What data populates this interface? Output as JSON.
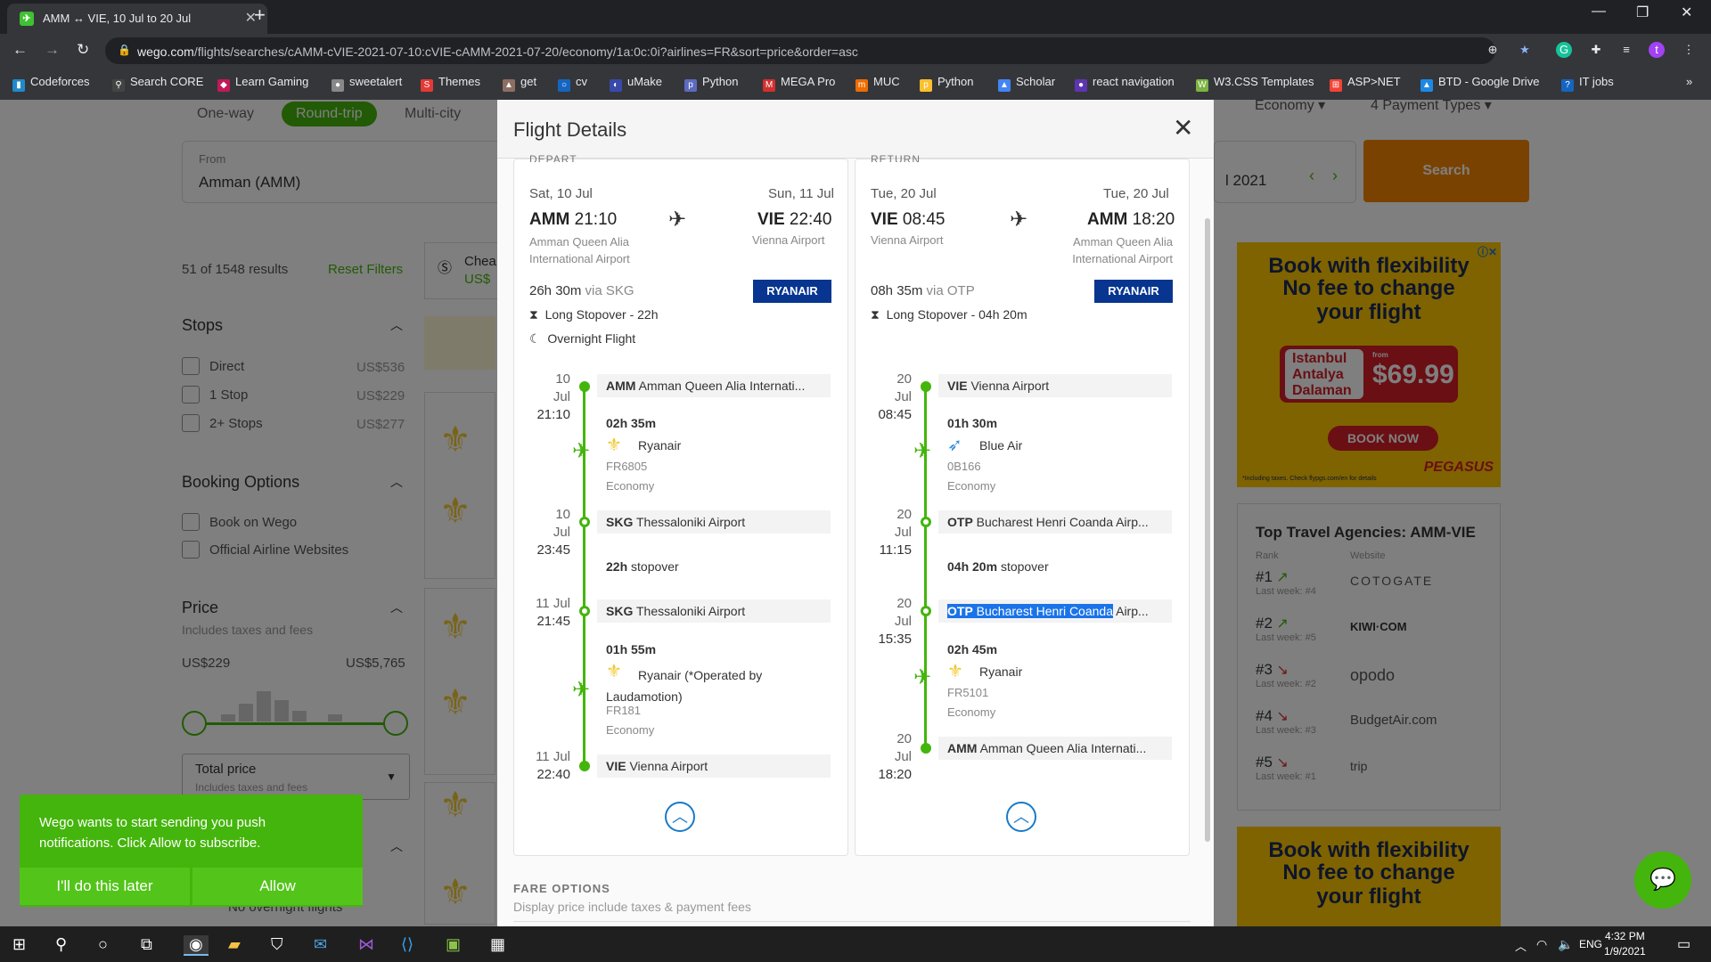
{
  "browser": {
    "tab_title": "AMM ↔ VIE, 10 Jul to 20 Jul",
    "url_host": "wego.com",
    "url_path": "/flights/searches/cAMM-cVIE-2021-07-10:cVIE-cAMM-2021-07-20/economy/1a:0c:0i?airlines=FR&sort=price&order=asc",
    "profile_initial": "t",
    "bookmarks": [
      "Codeforces",
      "Search CORE",
      "Learn Gaming",
      "sweetalert",
      "Themes",
      "get",
      "cv",
      "uMake",
      "Python",
      "MEGA Pro",
      "MUC",
      "Python",
      "Scholar",
      "react navigation",
      "W3.CSS Templates",
      "ASP>NET",
      "BTD - Google Drive",
      "IT jobs"
    ]
  },
  "search": {
    "trip_types": [
      "One-way",
      "Round-trip",
      "Multi-city"
    ],
    "cabin": "Economy",
    "payment": "4 Payment Types",
    "from_label": "From",
    "from_value": "Amman (AMM)",
    "date_fragment": "l 2021",
    "search_button": "Search"
  },
  "sidebar": {
    "results": "51 of 1548 results",
    "reset": "Reset Filters",
    "cheapest_tab": "Chea",
    "cheapest_price": "US$",
    "stops_title": "Stops",
    "stops": [
      {
        "label": "Direct",
        "price": "US$536"
      },
      {
        "label": "1 Stop",
        "price": "US$229"
      },
      {
        "label": "2+ Stops",
        "price": "US$277"
      }
    ],
    "booking_title": "Booking Options",
    "booking": [
      "Book on Wego",
      "Official Airline Websites"
    ],
    "price_title": "Price",
    "price_sub": "Includes taxes and fees",
    "price_min": "US$229",
    "price_max": "US$5,765",
    "total_price": "Total price",
    "total_price_sub": "Includes taxes and fees",
    "overnight": "No overnight flights"
  },
  "ad": {
    "headline": "Book with flexibility",
    "line2": "No fee to change",
    "line3": "your flight",
    "destinations": [
      "Istanbul",
      "Antalya",
      "Dalaman"
    ],
    "from": "from",
    "price": "$69.99",
    "cta": "BOOK NOW",
    "brand": "PEGASUS",
    "fine": "*Including taxes. Check flypgs.com/en for details"
  },
  "agencies": {
    "title": "Top Travel Agencies: AMM-VIE",
    "col_rank": "Rank",
    "col_site": "Website",
    "items": [
      {
        "rank": "#1",
        "last": "Last week: #4",
        "site": "COTOGATE"
      },
      {
        "rank": "#2",
        "last": "Last week: #5",
        "site": "KIWI·COM"
      },
      {
        "rank": "#3",
        "last": "Last week: #2",
        "site": "opodo"
      },
      {
        "rank": "#4",
        "last": "Last week: #3",
        "site": "BudgetAir.com"
      },
      {
        "rank": "#5",
        "last": "Last week: #1",
        "site": "trip"
      }
    ]
  },
  "modal": {
    "title": "Flight Details",
    "fare_title": "FARE OPTIONS",
    "fare_sub": "Display price include taxes & payment fees",
    "depart": {
      "heading": "DEPART",
      "date_from": "Sat, 10 Jul",
      "date_to": "Sun, 11 Jul",
      "from_code": "AMM",
      "from_time": "21:10",
      "to_code": "VIE",
      "to_time": "22:40",
      "from_airport": "Amman Queen Alia International Airport",
      "to_airport": "Vienna Airport",
      "duration": "26h 30m",
      "via": "via SKG",
      "airline_logo": "RYANAIR",
      "notes": [
        "Long Stopover - 22h",
        "Overnight Flight"
      ],
      "segments": [
        {
          "date": "10 Jul",
          "time": "21:10",
          "code": "AMM",
          "name": "Amman Queen Alia Internati..."
        },
        {
          "dur": "02h 35m",
          "airline": "Ryanair",
          "flight": "FR6805",
          "cabin": "Economy"
        },
        {
          "date": "10 Jul",
          "time": "23:45",
          "code": "SKG",
          "name": "Thessaloniki Airport"
        },
        {
          "stopover": "22h",
          "stopover_label": "stopover"
        },
        {
          "date": "11 Jul",
          "time": "21:45",
          "code": "SKG",
          "name": "Thessaloniki Airport"
        },
        {
          "dur": "01h 55m",
          "airline": "Ryanair (*Operated by Laudamotion)",
          "flight": "FR181",
          "cabin": "Economy"
        },
        {
          "date": "11 Jul",
          "time": "22:40",
          "code": "VIE",
          "name": "Vienna Airport"
        }
      ]
    },
    "return": {
      "heading": "RETURN",
      "date_from": "Tue, 20 Jul",
      "date_to": "Tue, 20 Jul",
      "from_code": "VIE",
      "from_time": "08:45",
      "to_code": "AMM",
      "to_time": "18:20",
      "from_airport": "Vienna Airport",
      "to_airport": "Amman Queen Alia International Airport",
      "duration": "08h 35m",
      "via": "via OTP",
      "airline_logo": "RYANAIR",
      "notes": [
        "Long Stopover - 04h 20m"
      ],
      "segments": [
        {
          "date": "20 Jul",
          "time": "08:45",
          "code": "VIE",
          "name": "Vienna Airport"
        },
        {
          "dur": "01h 30m",
          "airline": "Blue Air",
          "flight": "0B166",
          "cabin": "Economy"
        },
        {
          "date": "20 Jul",
          "time": "11:15",
          "code": "OTP",
          "name": "Bucharest Henri Coanda Airp..."
        },
        {
          "stopover": "04h 20m",
          "stopover_label": "stopover"
        },
        {
          "date": "20 Jul",
          "time": "15:35",
          "code": "OTP",
          "name_hl": "Bucharest Henri Coanda",
          "name_rest": " Airp..."
        },
        {
          "dur": "02h 45m",
          "airline": "Ryanair",
          "flight": "FR5101",
          "cabin": "Economy"
        },
        {
          "date": "20 Jul",
          "time": "18:20",
          "code": "AMM",
          "name": "Amman Queen Alia Internati..."
        }
      ]
    }
  },
  "notification": {
    "message": "Wego wants to start sending you push notifications. Click Allow to subscribe.",
    "later": "I'll do this later",
    "allow": "Allow"
  },
  "taskbar": {
    "lang": "ENG",
    "time": "4:32 PM",
    "date": "1/9/2021"
  }
}
